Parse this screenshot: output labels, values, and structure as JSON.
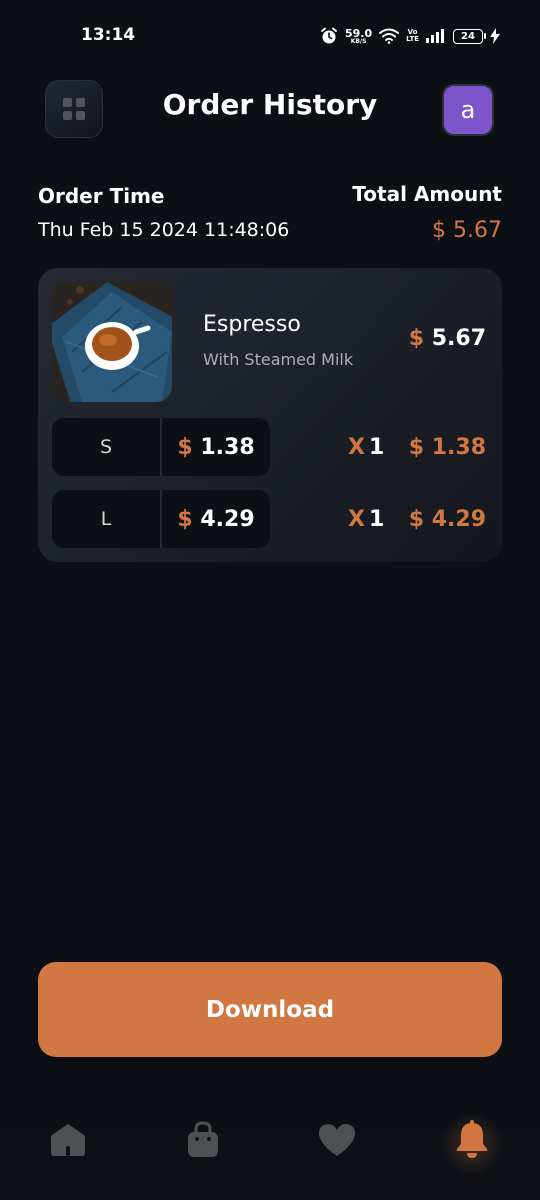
{
  "status_bar": {
    "time": "13:14",
    "net_speed_value": "59.0",
    "net_speed_unit": "KB/S",
    "volte_top": "Vo",
    "volte_bottom": "LTE",
    "battery_level": "24"
  },
  "header": {
    "title": "Order History",
    "avatar_letter": "a",
    "menu_icon": "grid-icon"
  },
  "order": {
    "time_label": "Order Time",
    "time_value": "Thu Feb 15 2024 11:48:06",
    "total_label": "Total Amount",
    "total_value": "$ 5.67"
  },
  "item": {
    "name": "Espresso",
    "description": "With Steamed Milk",
    "currency": "$",
    "price": "5.67",
    "sizes": [
      {
        "size": "S",
        "currency": "$",
        "price": "1.38",
        "qty_prefix": "X",
        "qty": "1",
        "line_total": "$ 1.38"
      },
      {
        "size": "L",
        "currency": "$",
        "price": "4.29",
        "qty_prefix": "X",
        "qty": "1",
        "line_total": "$ 4.29"
      }
    ]
  },
  "actions": {
    "download_label": "Download"
  },
  "nav": {
    "items": [
      {
        "icon": "home-icon",
        "active": false
      },
      {
        "icon": "shopping-bag-icon",
        "active": false
      },
      {
        "icon": "heart-icon",
        "active": false
      },
      {
        "icon": "bell-icon",
        "active": true
      }
    ]
  },
  "colors": {
    "accent": "#d17842",
    "background": "#0c0f14",
    "card": "#262b33",
    "inactive_icon": "#4e5053",
    "avatar": "#7b55c9"
  }
}
